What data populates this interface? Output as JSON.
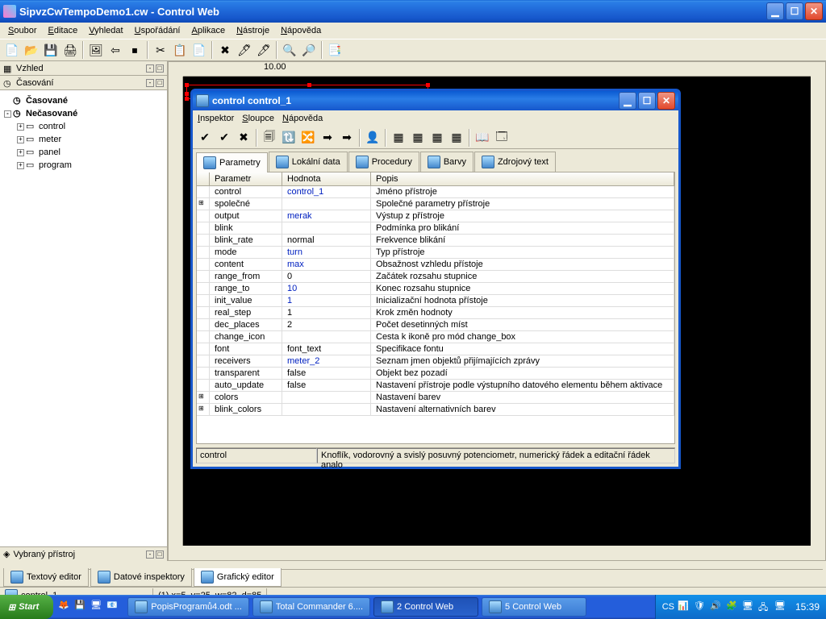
{
  "window": {
    "title": "SipvzCwTempoDemo1.cw - Control Web"
  },
  "menu": [
    "Soubor",
    "Editace",
    "Vyhledat",
    "Uspořádání",
    "Aplikace",
    "Nástroje",
    "Nápověda"
  ],
  "toolbar_glyphs": [
    "📄",
    "📂",
    "💾",
    "🖨",
    "|",
    "🖼",
    "⇦",
    "⏹",
    "|",
    "✂",
    "📋",
    "📄",
    "|",
    "✖",
    "🖊",
    "🖊",
    "|",
    "🔍",
    "🔎",
    "|",
    "📑"
  ],
  "left": {
    "vzhled": "Vzhled",
    "casovani": "Časování",
    "casovane": "Časované",
    "necasovane": "Nečasované",
    "items": [
      "control",
      "meter",
      "panel",
      "program"
    ],
    "vybrany": "Vybraný přístroj"
  },
  "ruler_tick": "10.00",
  "bottom_tabs": [
    "Textový editor",
    "Datové inspektory",
    "Grafický editor"
  ],
  "status": {
    "left": "control_1",
    "right": "(1) x=5, y=25, w=82, d=85"
  },
  "child": {
    "title": "control control_1",
    "menu": [
      "Inspektor",
      "Sloupce",
      "Nápověda"
    ],
    "toolbar_glyphs": [
      "✔",
      "✔",
      "✖",
      "|",
      "🗐",
      "🔃",
      "🔀",
      "➡",
      "➡",
      "|",
      "👤",
      "|",
      "▦",
      "▦",
      "▦",
      "▦",
      "|",
      "📖",
      "🗔"
    ],
    "tabs": [
      "Parametry",
      "Lokální data",
      "Procedury",
      "Barvy",
      "Zdrojový text"
    ],
    "headers": [
      "Parametr",
      "Hodnota",
      "Popis"
    ],
    "rows": [
      {
        "expand": "",
        "p": "control",
        "h": "control_1",
        "link": true,
        "d": "Jméno přístroje"
      },
      {
        "expand": "⊞",
        "p": "společné",
        "h": "",
        "d": "Společné parametry přístroje"
      },
      {
        "expand": "",
        "p": "output",
        "h": "merak",
        "link": true,
        "d": "Výstup z přístroje"
      },
      {
        "expand": "",
        "p": "blink",
        "h": "",
        "d": "Podmínka pro blikání"
      },
      {
        "expand": "",
        "p": "blink_rate",
        "h": "normal",
        "d": "Frekvence blikání"
      },
      {
        "expand": "",
        "p": "mode",
        "h": "turn",
        "link": true,
        "d": "Typ přístroje"
      },
      {
        "expand": "",
        "p": "content",
        "h": "max",
        "link": true,
        "d": "Obsažnost vzhledu přístoje"
      },
      {
        "expand": "",
        "p": "range_from",
        "h": "0",
        "d": "Začátek rozsahu stupnice"
      },
      {
        "expand": "",
        "p": "range_to",
        "h": "10",
        "link": true,
        "d": "Konec rozsahu stupnice"
      },
      {
        "expand": "",
        "p": "init_value",
        "h": "1",
        "link": true,
        "d": "Inicializační hodnota přístoje"
      },
      {
        "expand": "",
        "p": "real_step",
        "h": "1",
        "d": "Krok změn hodnoty"
      },
      {
        "expand": "",
        "p": "dec_places",
        "h": "2",
        "d": "Počet desetinných míst"
      },
      {
        "expand": "",
        "p": "change_icon",
        "h": "",
        "d": "Cesta k ikoně pro mód change_box"
      },
      {
        "expand": "",
        "p": "font",
        "h": "font_text",
        "d": "Specifikace fontu"
      },
      {
        "expand": "",
        "p": "receivers",
        "h": "meter_2",
        "link": true,
        "d": "Seznam jmen objektů přijímajících zprávy"
      },
      {
        "expand": "",
        "p": "transparent",
        "h": "false",
        "d": "Objekt bez pozadí"
      },
      {
        "expand": "",
        "p": "auto_update",
        "h": "false",
        "d": "Nastavení přístroje podle výstupního datového elementu během aktivace"
      },
      {
        "expand": "⊞",
        "p": "colors",
        "h": "",
        "d": "Nastavení barev"
      },
      {
        "expand": "⊞",
        "p": "blink_colors",
        "h": "",
        "d": "Nastavení alternativních barev"
      }
    ],
    "status": {
      "a": "control",
      "b": "Knoflík, vodorovný a svislý posuvný potenciometr, numerický řádek a editační řádek analo"
    }
  },
  "taskbar": {
    "start": "Start",
    "tasks": [
      {
        "label": "PopisProgramů4.odt ...",
        "active": false
      },
      {
        "label": "Total Commander 6....",
        "active": false
      },
      {
        "label": "2  Control Web",
        "active": true
      },
      {
        "label": "5  Control Web",
        "active": false
      }
    ],
    "lang": "CS",
    "clock": "15:39"
  }
}
